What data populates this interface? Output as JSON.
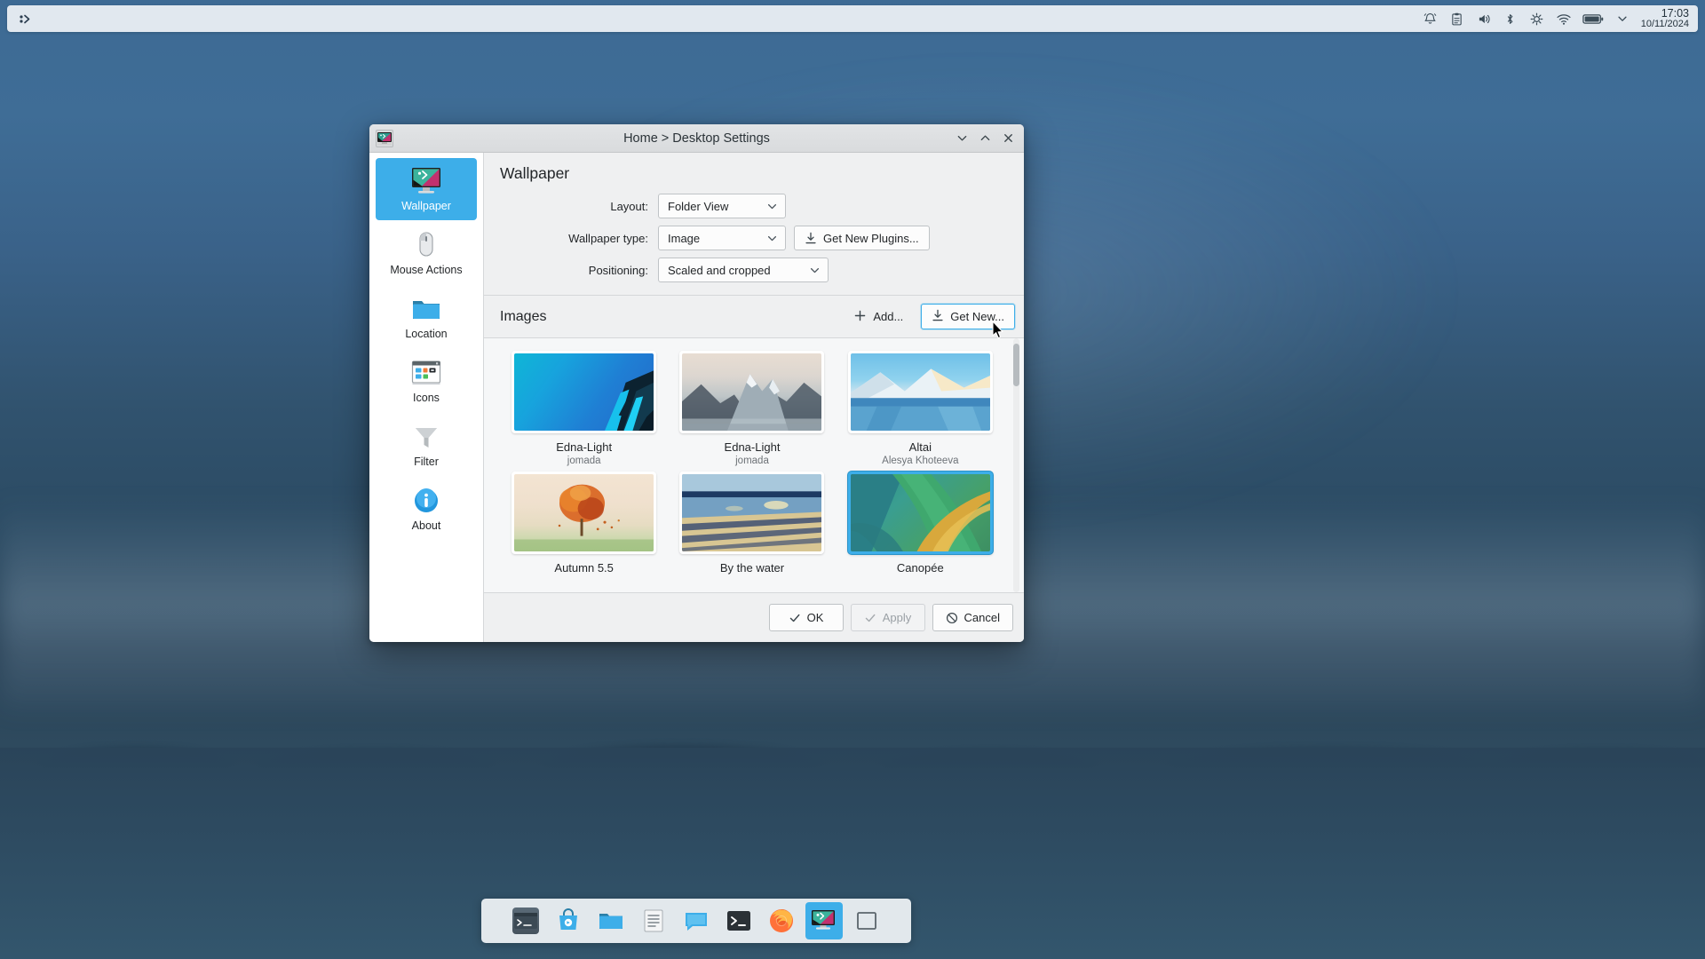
{
  "panel": {
    "launcher_icon": "application-launcher-icon",
    "tray_icons": [
      "notifications-icon",
      "clipboard-icon",
      "volume-icon",
      "bluetooth-icon",
      "brightness-icon",
      "network-wifi-icon",
      "battery-icon",
      "show-hidden-icons-chevron"
    ],
    "clock": {
      "time": "17:03",
      "date": "10/11/2024"
    }
  },
  "dialog": {
    "title": "Home > Desktop Settings",
    "window_icon": "desktop-settings-icon",
    "window_buttons": [
      {
        "name": "minimize-button",
        "glyph": "minimize-icon"
      },
      {
        "name": "maximize-button",
        "glyph": "maximize-icon"
      },
      {
        "name": "close-button",
        "glyph": "close-icon"
      }
    ],
    "sidebar": {
      "items": [
        {
          "label": "Wallpaper",
          "icon": "monitor-wallpaper-icon",
          "selected": true
        },
        {
          "label": "Mouse Actions",
          "icon": "mouse-icon",
          "selected": false
        },
        {
          "label": "Location",
          "icon": "folder-icon",
          "selected": false
        },
        {
          "label": "Icons",
          "icon": "window-icons-icon",
          "selected": false
        },
        {
          "label": "Filter",
          "icon": "funnel-filter-icon",
          "selected": false
        },
        {
          "label": "About",
          "icon": "info-circle-icon",
          "selected": false
        }
      ]
    },
    "page_title": "Wallpaper",
    "form": {
      "layout": {
        "label": "Layout:",
        "value": "Folder View"
      },
      "wallpaper_type": {
        "label": "Wallpaper type:",
        "value": "Image"
      },
      "get_new_plugins": {
        "label": "Get New Plugins...",
        "icon": "download-icon"
      },
      "positioning": {
        "label": "Positioning:",
        "value": "Scaled and cropped"
      }
    },
    "images": {
      "section_title": "Images",
      "add_button": {
        "label": "Add...",
        "icon": "plus-icon"
      },
      "get_new_button": {
        "label": "Get New...",
        "icon": "download-icon"
      },
      "items": [
        {
          "name": "Edna-Light",
          "author": "jomada",
          "selected": false,
          "thumb": "abstract-blue-building"
        },
        {
          "name": "Edna-Light",
          "author": "jomada",
          "selected": false,
          "thumb": "misty-mountains"
        },
        {
          "name": "Altai",
          "author": "Alesya Khoteeva",
          "selected": false,
          "thumb": "altai-lake"
        },
        {
          "name": "Autumn 5.5",
          "author": "",
          "selected": false,
          "thumb": "autumn-tree"
        },
        {
          "name": "By the water",
          "author": "",
          "selected": false,
          "thumb": "by-the-water"
        },
        {
          "name": "Canopée",
          "author": "",
          "selected": true,
          "thumb": "canopee-green"
        }
      ]
    },
    "footer": {
      "ok": {
        "label": "OK",
        "icon": "check-icon"
      },
      "apply": {
        "label": "Apply",
        "icon": "check-icon",
        "disabled": true
      },
      "cancel": {
        "label": "Cancel",
        "icon": "cancel-icon"
      }
    }
  },
  "dock": {
    "items": [
      {
        "name": "konsole",
        "icon": "terminal-icon",
        "active": false
      },
      {
        "name": "discover",
        "icon": "shopping-bag-icon",
        "active": false
      },
      {
        "name": "dolphin",
        "icon": "folder-icon",
        "active": false
      },
      {
        "name": "text-editor",
        "icon": "document-icon",
        "active": false
      },
      {
        "name": "messenger",
        "icon": "chat-bubble-icon",
        "active": false
      },
      {
        "name": "terminal-dark",
        "icon": "prompt-icon",
        "active": false
      },
      {
        "name": "firefox",
        "icon": "firefox-icon",
        "active": false
      },
      {
        "name": "desktop-settings",
        "icon": "desktop-settings-icon",
        "active": true
      },
      {
        "name": "show-desktop",
        "icon": "square-icon",
        "active": false
      }
    ]
  },
  "colors": {
    "accent": "#3daee9",
    "window_bg": "#eff0f1",
    "text": "#232629"
  }
}
